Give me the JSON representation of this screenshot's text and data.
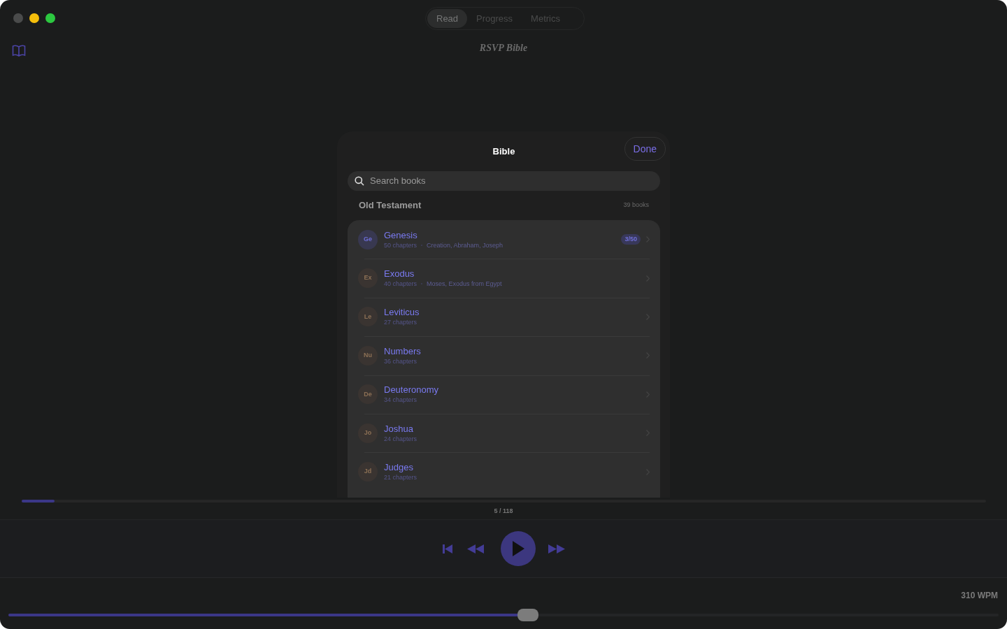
{
  "window": {
    "title": "RSVP Bible"
  },
  "segments": [
    {
      "label": "Read",
      "selected": true
    },
    {
      "label": "Progress",
      "selected": false
    },
    {
      "label": "Metrics",
      "selected": false
    }
  ],
  "sheet": {
    "title": "Bible",
    "done": "Done",
    "search": {
      "placeholder": "Search books"
    },
    "section": {
      "title": "Old Testament",
      "count": "39 books"
    },
    "books": [
      {
        "abbr": "Ge",
        "name": "Genesis",
        "chapters": "50 chapters",
        "topics": "Creation, Abraham, Joseph",
        "progress": "3/50",
        "selected": true
      },
      {
        "abbr": "Ex",
        "name": "Exodus",
        "chapters": "40 chapters",
        "topics": "Moses, Exodus from Egypt",
        "selected": false
      },
      {
        "abbr": "Le",
        "name": "Leviticus",
        "chapters": "27 chapters",
        "selected": false
      },
      {
        "abbr": "Nu",
        "name": "Numbers",
        "chapters": "36 chapters",
        "selected": false
      },
      {
        "abbr": "De",
        "name": "Deuteronomy",
        "chapters": "34 chapters",
        "selected": false
      },
      {
        "abbr": "Jo",
        "name": "Joshua",
        "chapters": "24 chapters",
        "selected": false
      },
      {
        "abbr": "Jd",
        "name": "Judges",
        "chapters": "21 chapters",
        "selected": false
      }
    ]
  },
  "reading_progress": {
    "level": 0.034,
    "label": "5 / 118"
  },
  "speed": {
    "reading": "310 WPM",
    "level": 0.525
  }
}
